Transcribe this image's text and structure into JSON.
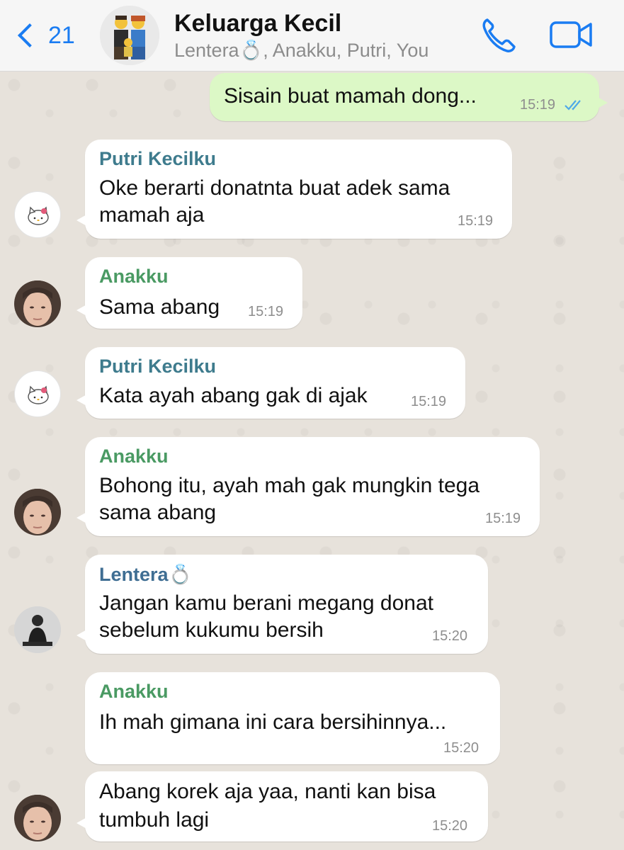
{
  "header": {
    "back_count": "21",
    "title": "Keluarga Kecil",
    "subtitle": "Lentera💍, Anakku, Putri, You"
  },
  "colors": {
    "accent": "#1a7cf2",
    "outgoing_bubble": "#dcf8c6",
    "incoming_bubble": "#ffffff",
    "putri_name": "#3e7b8d",
    "anakku_name": "#4a9a63",
    "lentera_name": "#3f6e93"
  },
  "icons": [
    "back-chevron-icon",
    "phone-icon",
    "video-call-icon",
    "read-ticks-icon"
  ],
  "messages": [
    {
      "sender": "",
      "direction": "out",
      "lines": [
        "Sisain buat mamah dong..."
      ],
      "time": "15:19",
      "status": "read"
    },
    {
      "sender": "Putri Kecilku",
      "direction": "in",
      "avatar": "hello-kitty",
      "lines": [
        "Oke berarti donatnta buat adek sama",
        "mamah aja"
      ],
      "time": "15:19"
    },
    {
      "sender": "Anakku",
      "direction": "in",
      "avatar": "face",
      "lines": [
        "Sama abang"
      ],
      "time": "15:19"
    },
    {
      "sender": "Putri Kecilku",
      "direction": "in",
      "avatar": "hello-kitty",
      "lines": [
        "Kata ayah abang gak di ajak"
      ],
      "time": "15:19"
    },
    {
      "sender": "Anakku",
      "direction": "in",
      "avatar": "face",
      "lines": [
        "Bohong itu, ayah mah gak mungkin tega",
        "sama abang"
      ],
      "time": "15:19"
    },
    {
      "sender": "Lentera💍",
      "direction": "in",
      "avatar": "person",
      "lines": [
        "Jangan kamu berani megang donat",
        "sebelum kukumu bersih"
      ],
      "time": "15:20"
    },
    {
      "sender": "Anakku",
      "direction": "in",
      "avatar": "",
      "lines": [
        "Ih mah gimana ini cara bersihinnya..."
      ],
      "time": "15:20"
    },
    {
      "sender": "",
      "direction": "in",
      "avatar": "face",
      "lines": [
        "Abang korek aja yaa, nanti kan bisa",
        "tumbuh lagi"
      ],
      "time": "15:20"
    }
  ]
}
